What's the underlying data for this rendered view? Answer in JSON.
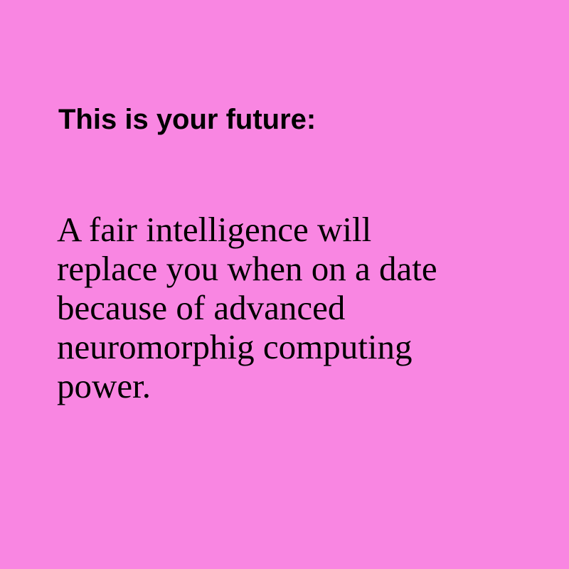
{
  "colors": {
    "background": "#f986e2",
    "text": "#000000"
  },
  "heading": "This is your future:",
  "body_lines": [
    "A fair intelligence will",
    "replace you when on a date",
    "because of advanced",
    "neuromorphig computing",
    "power."
  ]
}
